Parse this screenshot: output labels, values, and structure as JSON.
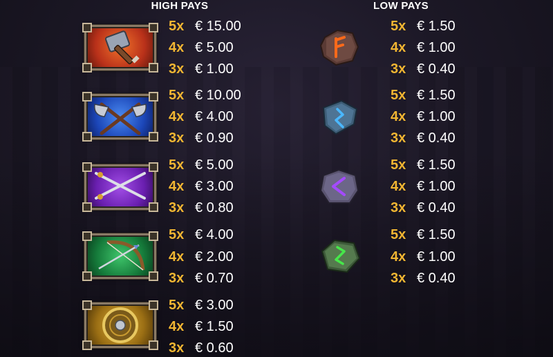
{
  "high_pays": {
    "title": "HIGH PAYS",
    "symbols": [
      {
        "icon": "hammer-icon",
        "pays": [
          {
            "mult": "5x",
            "amount": "€ 15.00"
          },
          {
            "mult": "4x",
            "amount": "€ 5.00"
          },
          {
            "mult": "3x",
            "amount": "€ 1.00"
          }
        ]
      },
      {
        "icon": "crossed-axes-icon",
        "pays": [
          {
            "mult": "5x",
            "amount": "€ 10.00"
          },
          {
            "mult": "4x",
            "amount": "€ 4.00"
          },
          {
            "mult": "3x",
            "amount": "€ 0.90"
          }
        ]
      },
      {
        "icon": "crossed-swords-icon",
        "pays": [
          {
            "mult": "5x",
            "amount": "€ 5.00"
          },
          {
            "mult": "4x",
            "amount": "€ 3.00"
          },
          {
            "mult": "3x",
            "amount": "€ 0.80"
          }
        ]
      },
      {
        "icon": "bow-and-arrow-icon",
        "pays": [
          {
            "mult": "5x",
            "amount": "€ 4.00"
          },
          {
            "mult": "4x",
            "amount": "€ 2.00"
          },
          {
            "mult": "3x",
            "amount": "€ 0.70"
          }
        ]
      },
      {
        "icon": "shield-icon",
        "pays": [
          {
            "mult": "5x",
            "amount": "€ 3.00"
          },
          {
            "mult": "4x",
            "amount": "€ 1.50"
          },
          {
            "mult": "3x",
            "amount": "€ 0.60"
          }
        ]
      }
    ]
  },
  "low_pays": {
    "title": "LOW PAYS",
    "symbols": [
      {
        "icon": "red-rune-stone-icon",
        "pays": [
          {
            "mult": "5x",
            "amount": "€ 1.50"
          },
          {
            "mult": "4x",
            "amount": "€ 1.00"
          },
          {
            "mult": "3x",
            "amount": "€ 0.40"
          }
        ]
      },
      {
        "icon": "blue-rune-stone-icon",
        "pays": [
          {
            "mult": "5x",
            "amount": "€ 1.50"
          },
          {
            "mult": "4x",
            "amount": "€ 1.00"
          },
          {
            "mult": "3x",
            "amount": "€ 0.40"
          }
        ]
      },
      {
        "icon": "purple-rune-stone-icon",
        "pays": [
          {
            "mult": "5x",
            "amount": "€ 1.50"
          },
          {
            "mult": "4x",
            "amount": "€ 1.00"
          },
          {
            "mult": "3x",
            "amount": "€ 0.40"
          }
        ]
      },
      {
        "icon": "green-rune-stone-icon",
        "pays": [
          {
            "mult": "5x",
            "amount": "€ 1.50"
          },
          {
            "mult": "4x",
            "amount": "€ 1.00"
          },
          {
            "mult": "3x",
            "amount": "€ 0.40"
          }
        ]
      }
    ]
  },
  "colors": {
    "multiplier": "#f2b632",
    "amount": "#ffffff",
    "background": "#1c1826"
  }
}
